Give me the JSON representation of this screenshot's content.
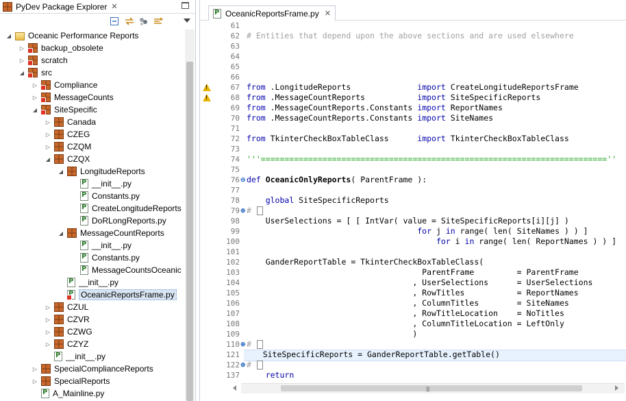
{
  "explorer": {
    "tab_title": "PyDev Package Explorer",
    "tree": [
      {
        "depth": 0,
        "label": "Oceanic Performance Reports",
        "icon": "project-icon",
        "expanded": true
      },
      {
        "depth": 1,
        "label": "backup_obsolete",
        "icon": "package-error-icon",
        "expanded": false
      },
      {
        "depth": 1,
        "label": "scratch",
        "icon": "package-error-icon",
        "expanded": false
      },
      {
        "depth": 1,
        "label": "src",
        "icon": "package-error-icon",
        "expanded": true
      },
      {
        "depth": 2,
        "label": "Compliance",
        "icon": "package-error-icon",
        "expanded": false
      },
      {
        "depth": 2,
        "label": "MessageCounts",
        "icon": "package-error-icon",
        "expanded": false
      },
      {
        "depth": 2,
        "label": "SiteSpecific",
        "icon": "package-error-icon",
        "expanded": true
      },
      {
        "depth": 3,
        "label": "Canada",
        "icon": "package-icon",
        "expanded": false
      },
      {
        "depth": 3,
        "label": "CZEG",
        "icon": "package-icon",
        "expanded": false
      },
      {
        "depth": 3,
        "label": "CZQM",
        "icon": "package-icon",
        "expanded": false
      },
      {
        "depth": 3,
        "label": "CZQX",
        "icon": "package-icon",
        "expanded": true
      },
      {
        "depth": 4,
        "label": "LongitudeReports",
        "icon": "package-icon",
        "expanded": true
      },
      {
        "depth": 5,
        "label": "__init__.py",
        "icon": "python-file-icon",
        "expanded": false
      },
      {
        "depth": 5,
        "label": "Constants.py",
        "icon": "python-file-icon",
        "expanded": false
      },
      {
        "depth": 5,
        "label": "CreateLongitudeReports",
        "icon": "python-file-icon",
        "expanded": false
      },
      {
        "depth": 5,
        "label": "DoRLongReports.py",
        "icon": "python-file-icon",
        "expanded": false
      },
      {
        "depth": 4,
        "label": "MessageCountReports",
        "icon": "package-icon",
        "expanded": true
      },
      {
        "depth": 5,
        "label": "__init__.py",
        "icon": "python-file-icon",
        "expanded": false
      },
      {
        "depth": 5,
        "label": "Constants.py",
        "icon": "python-file-icon",
        "expanded": false
      },
      {
        "depth": 5,
        "label": "MessageCountsOceanic",
        "icon": "python-file-icon",
        "expanded": false
      },
      {
        "depth": 4,
        "label": "__init__.py",
        "icon": "python-file-icon",
        "expanded": false
      },
      {
        "depth": 4,
        "label": "OceanicReportsFrame.py",
        "icon": "python-file-error-icon",
        "expanded": false,
        "selected": true
      },
      {
        "depth": 3,
        "label": "CZUL",
        "icon": "package-icon",
        "expanded": false
      },
      {
        "depth": 3,
        "label": "CZVR",
        "icon": "package-icon",
        "expanded": false
      },
      {
        "depth": 3,
        "label": "CZWG",
        "icon": "package-icon",
        "expanded": false
      },
      {
        "depth": 3,
        "label": "CZYZ",
        "icon": "package-icon",
        "expanded": false
      },
      {
        "depth": 3,
        "label": "__init__.py",
        "icon": "python-file-icon",
        "expanded": false
      },
      {
        "depth": 2,
        "label": "SpecialComplianceReports",
        "icon": "package-icon",
        "expanded": false
      },
      {
        "depth": 2,
        "label": "SpecialReports",
        "icon": "package-icon",
        "expanded": false
      },
      {
        "depth": 2,
        "label": "A_Mainline.py",
        "icon": "python-file-icon",
        "expanded": false
      }
    ]
  },
  "editor": {
    "tab_title": "OceanicReportsFrame.py",
    "lines": [
      {
        "n": "61",
        "code": ""
      },
      {
        "n": "62",
        "code": "# Entities that depend upon the above sections and are used elsewhere",
        "kind": "comment"
      },
      {
        "n": "63",
        "code": ""
      },
      {
        "n": "64",
        "code": ""
      },
      {
        "n": "65",
        "code": ""
      },
      {
        "n": "66",
        "code": ""
      },
      {
        "n": "67",
        "code": "from .LongitudeReports              import CreateLongitudeReportsFrame",
        "kind": "import",
        "warn": true
      },
      {
        "n": "68",
        "code": "from .MessageCountReports           import SiteSpecificReports",
        "kind": "import",
        "warn": true
      },
      {
        "n": "69",
        "code": "from .MessageCountReports.Constants import ReportNames",
        "kind": "import"
      },
      {
        "n": "70",
        "code": "from .MessageCountReports.Constants import SiteNames",
        "kind": "import"
      },
      {
        "n": "71",
        "code": ""
      },
      {
        "n": "72",
        "code": "from TkinterCheckBoxTableClass      import TkinterCheckBoxTableClass",
        "kind": "import"
      },
      {
        "n": "73",
        "code": ""
      },
      {
        "n": "74",
        "code": "'''=========================================================================''",
        "kind": "string"
      },
      {
        "n": "75",
        "code": ""
      },
      {
        "n": "76",
        "code": "def OceanicOnlyReports( ParentFrame ):",
        "kind": "def",
        "fold": "-"
      },
      {
        "n": "77",
        "code": ""
      },
      {
        "n": "78",
        "code": "    global SiteSpecificReports",
        "kind": "global"
      },
      {
        "n": "79",
        "code": "#",
        "kind": "folded",
        "fold": "+"
      },
      {
        "n": "98",
        "code": "    UserSelections = [ [ IntVar( value = SiteSpecificReports[i][j] )"
      },
      {
        "n": "99",
        "code": "                                    for j in range( len( SiteNames ) ) ]",
        "kind": "for"
      },
      {
        "n": "100",
        "code": "                                        for i in range( len( ReportNames ) ) ]",
        "kind": "for"
      },
      {
        "n": "101",
        "code": ""
      },
      {
        "n": "102",
        "code": "    GanderReportTable = TkinterCheckBoxTableClass("
      },
      {
        "n": "103",
        "code": "                                     ParentFrame         = ParentFrame"
      },
      {
        "n": "104",
        "code": "                                   , UserSelections      = UserSelections"
      },
      {
        "n": "105",
        "code": "                                   , RowTitles           = ReportNames"
      },
      {
        "n": "106",
        "code": "                                   , ColumnTitles        = SiteNames"
      },
      {
        "n": "107",
        "code": "                                   , RowTitleLocation    = NoTitles"
      },
      {
        "n": "108",
        "code": "                                   , ColumnTitleLocation = LeftOnly"
      },
      {
        "n": "109",
        "code": "                                   )"
      },
      {
        "n": "110",
        "code": "#",
        "kind": "folded",
        "fold": "+"
      },
      {
        "n": "121",
        "code": "    SiteSpecificReports = GanderReportTable.getTable()",
        "current": true
      },
      {
        "n": "122",
        "code": "#",
        "kind": "folded",
        "fold": "+"
      },
      {
        "n": "137",
        "code": "    return",
        "kind": "return"
      }
    ]
  },
  "colors": {
    "keyword": "#0000aa",
    "comment": "#a0a0a0",
    "string": "#19a319",
    "current_line": "#e8f2fe",
    "selection": "#d9e5f3"
  }
}
